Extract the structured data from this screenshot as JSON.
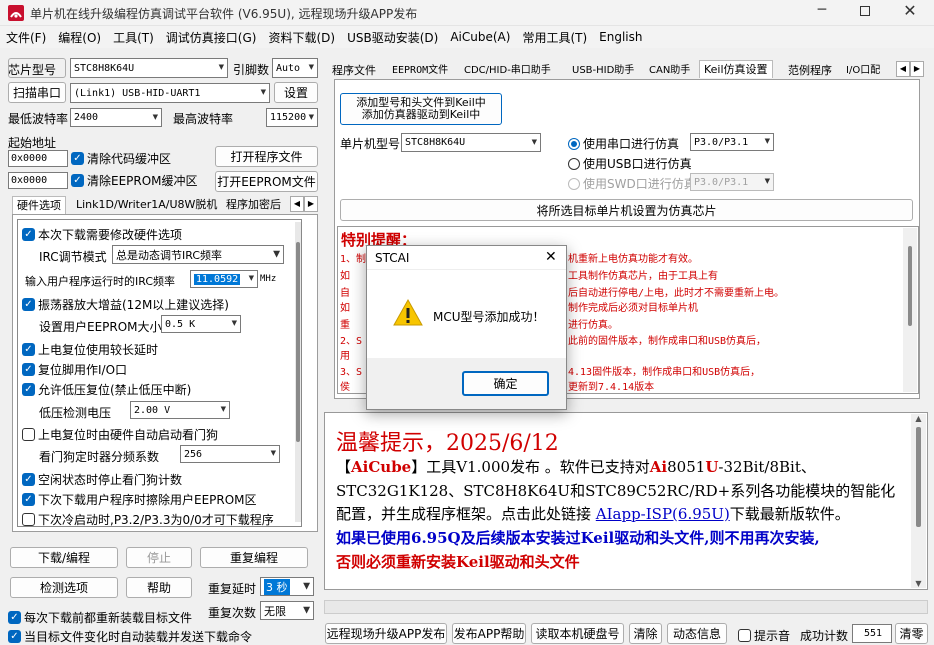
{
  "window": {
    "title": "单片机在线升级编程仿真调试平台软件 (V6.95U), 远程现场升级APP发布"
  },
  "menu": [
    "文件(F)",
    "编程(O)",
    "工具(T)",
    "调试仿真接口(G)",
    "资料下载(D)",
    "USB驱动安装(D)",
    "AiCube(A)",
    "常用工具(T)",
    "English"
  ],
  "left": {
    "chip_label": "芯片型号",
    "chip_value": "STC8H8K64U",
    "pin_label": "引脚数",
    "pin_value": "Auto",
    "scan_button": "扫描串口",
    "port_value": "(Link1) USB-HID-UART1",
    "settings_button": "设置",
    "min_baud_label": "最低波特率",
    "min_baud_value": "2400",
    "max_baud_label": "最高波特率",
    "max_baud_value": "115200",
    "start_addr_label": "起始地址",
    "addr1": "0x0000",
    "clear_code_label": "清除代码缓冲区",
    "open_program_button": "打开程序文件",
    "addr2": "0x0000",
    "clear_eeprom_label": "清除EEPROM缓冲区",
    "open_eeprom_button": "打开EEPROM文件",
    "tabs": [
      "硬件选项",
      "Link1D/Writer1A/U8W脱机",
      "程序加密后"
    ],
    "options": {
      "opt1": "本次下载需要修改硬件选项",
      "irc_mode_label": "IRC调节模式",
      "irc_mode_value": "总是动态调节IRC频率",
      "irc_freq_label": "输入用户程序运行时的IRC频率",
      "irc_freq_value": "11.0592",
      "irc_unit": "MHz",
      "opt_osc": "振荡器放大增益(12M以上建议选择)",
      "eeprom_size_label": "设置用户EEPROM大小",
      "eeprom_size_value": "0.5 K",
      "opt_por": "上电复位使用较长延时",
      "opt_reset": "复位脚用作I/O口",
      "opt_lvr": "允许低压复位(禁止低压中断)",
      "lvd_label": "低压检测电压",
      "lvd_value": "2.00 V",
      "opt_wdt": "上电复位时由硬件自动启动看门狗",
      "wdt_div_label": "看门狗定时器分频系数",
      "wdt_div_value": "256",
      "opt_idle": "空闲状态时停止看门狗计数",
      "opt_erase": "下次下载用户程序时擦除用户EEPROM区",
      "opt_cold": "下次冷启动时,P3.2/P3.3为0/0才可下载程序"
    },
    "download_button": "下载/编程",
    "stop_button": "停止",
    "reprogram_button": "重复编程",
    "check_button": "检测选项",
    "help_button": "帮助",
    "repeat_delay_label": "重复延时",
    "repeat_delay_value": "3 秒",
    "repeat_count_label": "重复次数",
    "repeat_count_value": "无限",
    "reload_label": "每次下载前都重新装载目标文件",
    "autoload_label": "当目标文件变化时自动装载并发送下载命令"
  },
  "right": {
    "tabs": [
      "程序文件",
      "EEPROM文件",
      "CDC/HID-串口助手",
      "USB-HID助手",
      "CAN助手",
      "Keil仿真设置",
      "范例程序",
      "I/O口配"
    ],
    "add_keil_button_line1": "添加型号和头文件到Keil中",
    "add_keil_button_line2": "添加仿真器驱动到Keil中",
    "mcu_label": "单片机型号",
    "mcu_value": "STC8H8K64U",
    "radio_serial": "使用串口进行仿真",
    "serial_port_value": "P3.0/P3.1",
    "radio_usb": "使用USB口进行仿真",
    "radio_swd": "使用SWD口进行仿真",
    "swd_port_value": "P3.0/P3.1",
    "set_chip_button": "将所选目标单片机设置为仿真芯片",
    "notice_title": "特别提醒：",
    "notice_lines": [
      "1、制",
      "   如",
      "   自",
      "   如",
      "   重",
      "2、S",
      "   用",
      "3、S",
      "   侯"
    ],
    "notice_right": [
      "机重新上电仿真功能才有效。",
      "工具制作仿真芯片，由于工具上有",
      "后自动进行停电/上电，此时才不需要重新上电。",
      "制作完成后必须对目标单片机",
      "进行仿真。",
      "此前的固件版本，制作成串口和USB仿真后，",
      "",
      "4.13固件版本，制作成串口和USB仿真后，",
      "更新到7.4.14版本"
    ],
    "tip": {
      "title": "温馨提示，2025/6/12",
      "aicube": "AiCube",
      "p1a": "工具V1.000发布 。软件已支持对",
      "ai": "Ai",
      "p1b": "8051",
      "u": "U",
      "p1c": "-32Bit/8Bit、",
      "p2": "STC32G1K128、STC8H8K64U和STC89C52RC/RD+系列各功能模块的智能化",
      "p3a": "配置，并生成程序框架。点击此处链接 ",
      "link": "AIapp-ISP(6.95U)",
      "p3b": "下载最新版软件。",
      "blue1": "如果已使用6.95Q及后续版本安装过Keil驱动和头文件,则不用再次安装,",
      "red1": "否则必须重新安装Keil驱动和头文件"
    },
    "bottom": {
      "remote_button": "远程现场升级APP发布",
      "publish_button": "发布APP帮助",
      "read_disk_button": "读取本机硬盘号",
      "clear_button": "清除",
      "status_button": "动态信息",
      "beep_label": "提示音",
      "success_label": "成功计数",
      "success_value": "551",
      "clear2_button": "清零"
    }
  },
  "dialog": {
    "title": "STCAI",
    "message": "MCU型号添加成功！",
    "ok_button": "确定"
  },
  "colors": {
    "accent": "#0067c0",
    "red": "#d00000",
    "blue": "#0000c8"
  }
}
